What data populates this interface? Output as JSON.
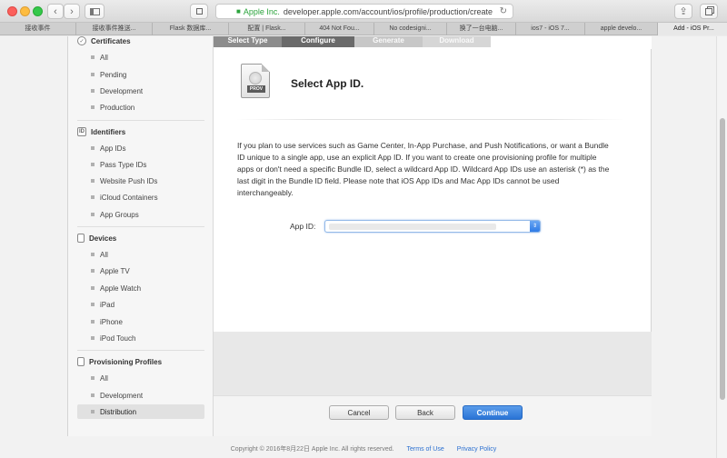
{
  "browser": {
    "url_org": "Apple Inc.",
    "url": "developer.apple.com/account/ios/profile/production/create",
    "tabs": [
      "接收事件推送...",
      "Flask 数据库...",
      "配置 | Flask...",
      "404 Not Fou...",
      "No codesigni...",
      "换了一台电脑...",
      "ios7 - iOS 7...",
      "apple develo...",
      "Add - iOS Pr..."
    ],
    "first_tab": "接收事件"
  },
  "sidebar": {
    "certificates": {
      "title": "Certificates",
      "items": [
        "All",
        "Pending",
        "Development",
        "Production"
      ]
    },
    "identifiers": {
      "title": "Identifiers",
      "items": [
        "App IDs",
        "Pass Type IDs",
        "Website Push IDs",
        "iCloud Containers",
        "App Groups"
      ]
    },
    "devices": {
      "title": "Devices",
      "items": [
        "All",
        "Apple TV",
        "Apple Watch",
        "iPad",
        "iPhone",
        "iPod Touch"
      ]
    },
    "profiles": {
      "title": "Provisioning Profiles",
      "items": [
        "All",
        "Development",
        "Distribution"
      ]
    }
  },
  "steps": [
    "Select Type",
    "Configure",
    "Generate",
    "Download"
  ],
  "main": {
    "icon_label": "PROV",
    "title": "Select App ID.",
    "description": "If you plan to use services such as Game Center, In-App Purchase, and Push Notifications, or want a Bundle ID unique to a single app, use an explicit App ID. If you want to create one provisioning profile for multiple apps or don't need a specific Bundle ID, select a wildcard App ID. Wildcard App IDs use an asterisk (*) as the last digit in the Bundle ID field. Please note that iOS App IDs and Mac App IDs cannot be used interchangeably.",
    "appid_label": "App ID:"
  },
  "buttons": {
    "cancel": "Cancel",
    "back": "Back",
    "continue": "Continue"
  },
  "footer": {
    "copyright": "Copyright © 2016年8月22日 Apple Inc. All rights reserved.",
    "terms": "Terms of Use",
    "privacy": "Privacy Policy"
  }
}
